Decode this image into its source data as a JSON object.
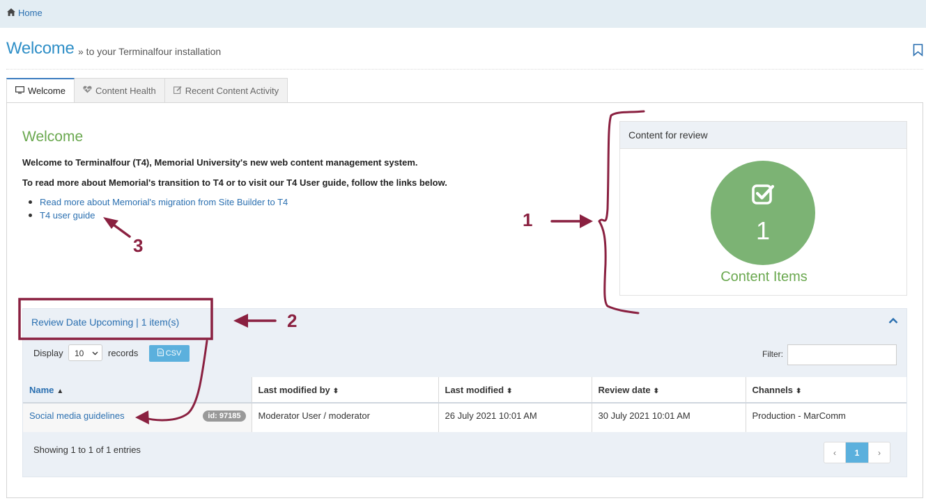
{
  "topbar": {
    "home_label": "Home",
    "home_icon": "home-icon"
  },
  "header": {
    "title": "Welcome",
    "subtitle": "» to your Terminalfour installation",
    "bookmark_icon": "bookmark-icon"
  },
  "tabs": [
    {
      "label": "Welcome",
      "icon": "monitor-icon",
      "active": true
    },
    {
      "label": "Content Health",
      "icon": "heartbeat-icon",
      "active": false
    },
    {
      "label": "Recent Content Activity",
      "icon": "edit-icon",
      "active": false
    }
  ],
  "welcome": {
    "heading": "Welcome",
    "intro_1": "Welcome to Terminalfour (T4), Memorial University's new web content management system.",
    "intro_2": "To read more about Memorial's transition to T4 or to visit our T4 User guide, follow the links below.",
    "links": [
      "Read more about Memorial's migration from Site Builder to T4",
      "T4 user guide"
    ]
  },
  "review_box": {
    "title": "Content for review",
    "count": "1",
    "caption": "Content Items",
    "circle_color": "#7cb374"
  },
  "upcoming": {
    "title": "Review Date Upcoming | 1 item(s)",
    "display_label": "Display",
    "display_value": "10",
    "records_label": "records",
    "csv_label": "CSV",
    "filter_label": "Filter:",
    "columns": [
      "Name",
      "Last modified by",
      "Last modified",
      "Review date",
      "Channels"
    ],
    "rows": [
      {
        "name": "Social media guidelines",
        "id_badge": "id: 97185",
        "modified_by": "Moderator User / moderator",
        "last_modified": "26 July 2021 10:01 AM",
        "review_date": "30 July 2021 10:01 AM",
        "channels": "Production - MarComm"
      }
    ],
    "showing": "Showing 1 to 1 of 1 entries",
    "pager": {
      "prev": "‹",
      "current": "1",
      "next": "›"
    }
  },
  "annotations": {
    "n1": "1",
    "n2": "2",
    "n3": "3",
    "color": "#8a2040"
  }
}
